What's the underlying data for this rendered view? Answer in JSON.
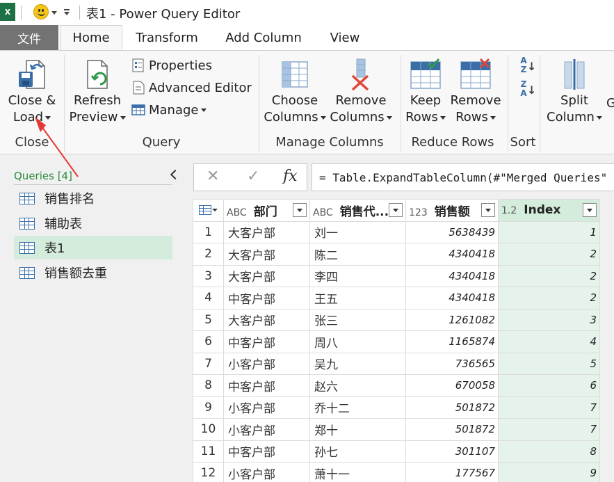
{
  "title_bar": {
    "app_icon": "X",
    "title": "表1 - Power Query Editor",
    "icons": [
      "excel-icon",
      "smiley-icon",
      "dropdown-caret-icon",
      "customize-toolbar-icon"
    ]
  },
  "tabs": {
    "file": "文件",
    "items": [
      "Home",
      "Transform",
      "Add Column",
      "View"
    ],
    "active": "Home"
  },
  "ribbon": {
    "close_load": {
      "line1": "Close &",
      "line2": "Load"
    },
    "refresh_preview": {
      "line1": "Refresh",
      "line2": "Preview"
    },
    "properties": "Properties",
    "advanced_editor": "Advanced Editor",
    "manage": "Manage",
    "choose_columns": {
      "line1": "Choose",
      "line2": "Columns"
    },
    "remove_columns": {
      "line1": "Remove",
      "line2": "Columns"
    },
    "keep_rows": {
      "line1": "Keep",
      "line2": "Rows"
    },
    "remove_rows": {
      "line1": "Remove",
      "line2": "Rows"
    },
    "sort_az": "A Z",
    "sort_za": "Z A",
    "split_column": {
      "line1": "Split",
      "line2": "Column"
    },
    "next_partial": "G",
    "groups": {
      "close": "Close",
      "query": "Query",
      "manage_columns": "Manage Columns",
      "reduce_rows": "Reduce Rows",
      "sort": "Sort"
    }
  },
  "queries_pane": {
    "header": "Queries [4]",
    "items": [
      {
        "name": "销售排名",
        "selected": false
      },
      {
        "name": "辅助表",
        "selected": false
      },
      {
        "name": "表1",
        "selected": true
      },
      {
        "name": "销售额去重",
        "selected": false
      }
    ]
  },
  "formula_bar": {
    "cancel_symbol": "✕",
    "commit_symbol": "✓",
    "fx_symbol": "fx",
    "formula": "= Table.ExpandTableColumn(#\"Merged Queries\""
  },
  "grid": {
    "columns": [
      {
        "type_badge": "ABC",
        "name": "部门"
      },
      {
        "type_badge": "ABC",
        "name": "销售代..."
      },
      {
        "type_badge": "123",
        "name": "销售额"
      },
      {
        "type_badge": "1.2",
        "name": "Index"
      }
    ],
    "rows": [
      {
        "n": "1",
        "dept": "大客户部",
        "rep": "刘一",
        "sales": "5638439",
        "index": "1"
      },
      {
        "n": "2",
        "dept": "大客户部",
        "rep": "陈二",
        "sales": "4340418",
        "index": "2"
      },
      {
        "n": "3",
        "dept": "大客户部",
        "rep": "李四",
        "sales": "4340418",
        "index": "2"
      },
      {
        "n": "4",
        "dept": "中客户部",
        "rep": "王五",
        "sales": "4340418",
        "index": "2"
      },
      {
        "n": "5",
        "dept": "大客户部",
        "rep": "张三",
        "sales": "1261082",
        "index": "3"
      },
      {
        "n": "6",
        "dept": "中客户部",
        "rep": "周八",
        "sales": "1165874",
        "index": "4"
      },
      {
        "n": "7",
        "dept": "小客户部",
        "rep": "吴九",
        "sales": "736565",
        "index": "5"
      },
      {
        "n": "8",
        "dept": "中客户部",
        "rep": "赵六",
        "sales": "670058",
        "index": "6"
      },
      {
        "n": "9",
        "dept": "小客户部",
        "rep": "乔十二",
        "sales": "501872",
        "index": "7"
      },
      {
        "n": "10",
        "dept": "小客户部",
        "rep": "郑十",
        "sales": "501872",
        "index": "7"
      },
      {
        "n": "11",
        "dept": "中客户部",
        "rep": "孙七",
        "sales": "301107",
        "index": "8"
      },
      {
        "n": "12",
        "dept": "小客户部",
        "rep": "萧十一",
        "sales": "177567",
        "index": "9"
      }
    ]
  },
  "colors": {
    "excel_green": "#1e7145",
    "file_tab": "#737373",
    "selection_green": "#d4ecdc",
    "annotation_red": "#e53935",
    "icon_blue": "#3b6ea8"
  }
}
